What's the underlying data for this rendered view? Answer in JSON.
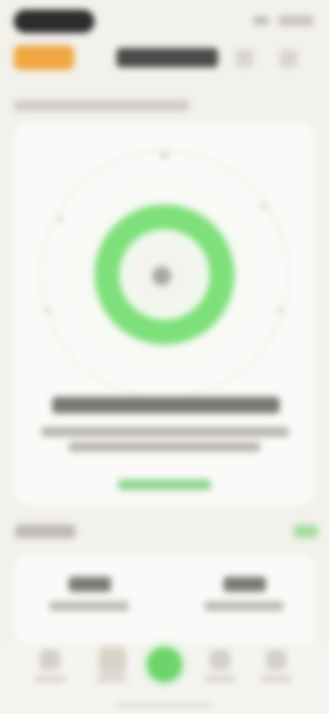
{
  "status_bar": {
    "time": "",
    "battery": ""
  },
  "header": {
    "title": "",
    "badge": ""
  },
  "section": {
    "caption": ""
  },
  "score_card": {
    "center_label": "",
    "recommendation_title": "",
    "recommendation_lines": [
      "",
      ""
    ],
    "action_link": ""
  },
  "stats": {
    "title": "",
    "more_label": "",
    "items": [
      {
        "value": "",
        "label": ""
      },
      {
        "value": "",
        "label": ""
      }
    ]
  },
  "bottom_nav": {
    "items": [
      {
        "icon": "home-icon",
        "label": ""
      },
      {
        "icon": "chart-icon",
        "label": ""
      },
      {
        "icon": "plus-icon",
        "label": ""
      },
      {
        "icon": "calendar-icon",
        "label": ""
      },
      {
        "icon": "profile-icon",
        "label": ""
      }
    ]
  },
  "colors": {
    "background": "#f3f1ec",
    "card": "#fbfaf8",
    "accent_green": "#6ed36a",
    "brand_orange": "#f0a742"
  }
}
